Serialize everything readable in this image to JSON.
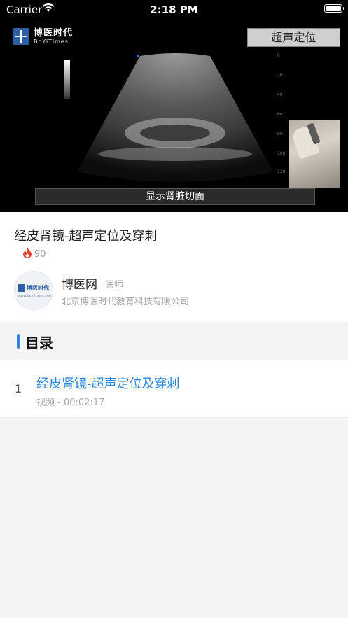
{
  "status_bar": {
    "carrier": "Carrier",
    "time": "2:18 PM"
  },
  "video": {
    "logo_cn": "博医时代",
    "logo_en": "BoYiTimes",
    "tag": "超声定位",
    "caption": "显示肾脏切面"
  },
  "course": {
    "title": "经皮肾镜-超声定位及穿刺",
    "heat": "90"
  },
  "author": {
    "name": "博医网",
    "role": "医师",
    "organization": "北京博医时代教育科技有限公司",
    "avatar_text": "博医时代",
    "avatar_url": "www.boyitimes.com"
  },
  "catalog": {
    "title": "目录",
    "items": [
      {
        "index": "1",
        "title": "经皮肾镜-超声定位及穿刺",
        "meta": "视频 - 00:02:17"
      }
    ]
  },
  "colors": {
    "accent": "#2a88dc",
    "heat": "#e8402e"
  },
  "icons": [
    "wifi-icon",
    "battery-icon",
    "flame-icon"
  ]
}
